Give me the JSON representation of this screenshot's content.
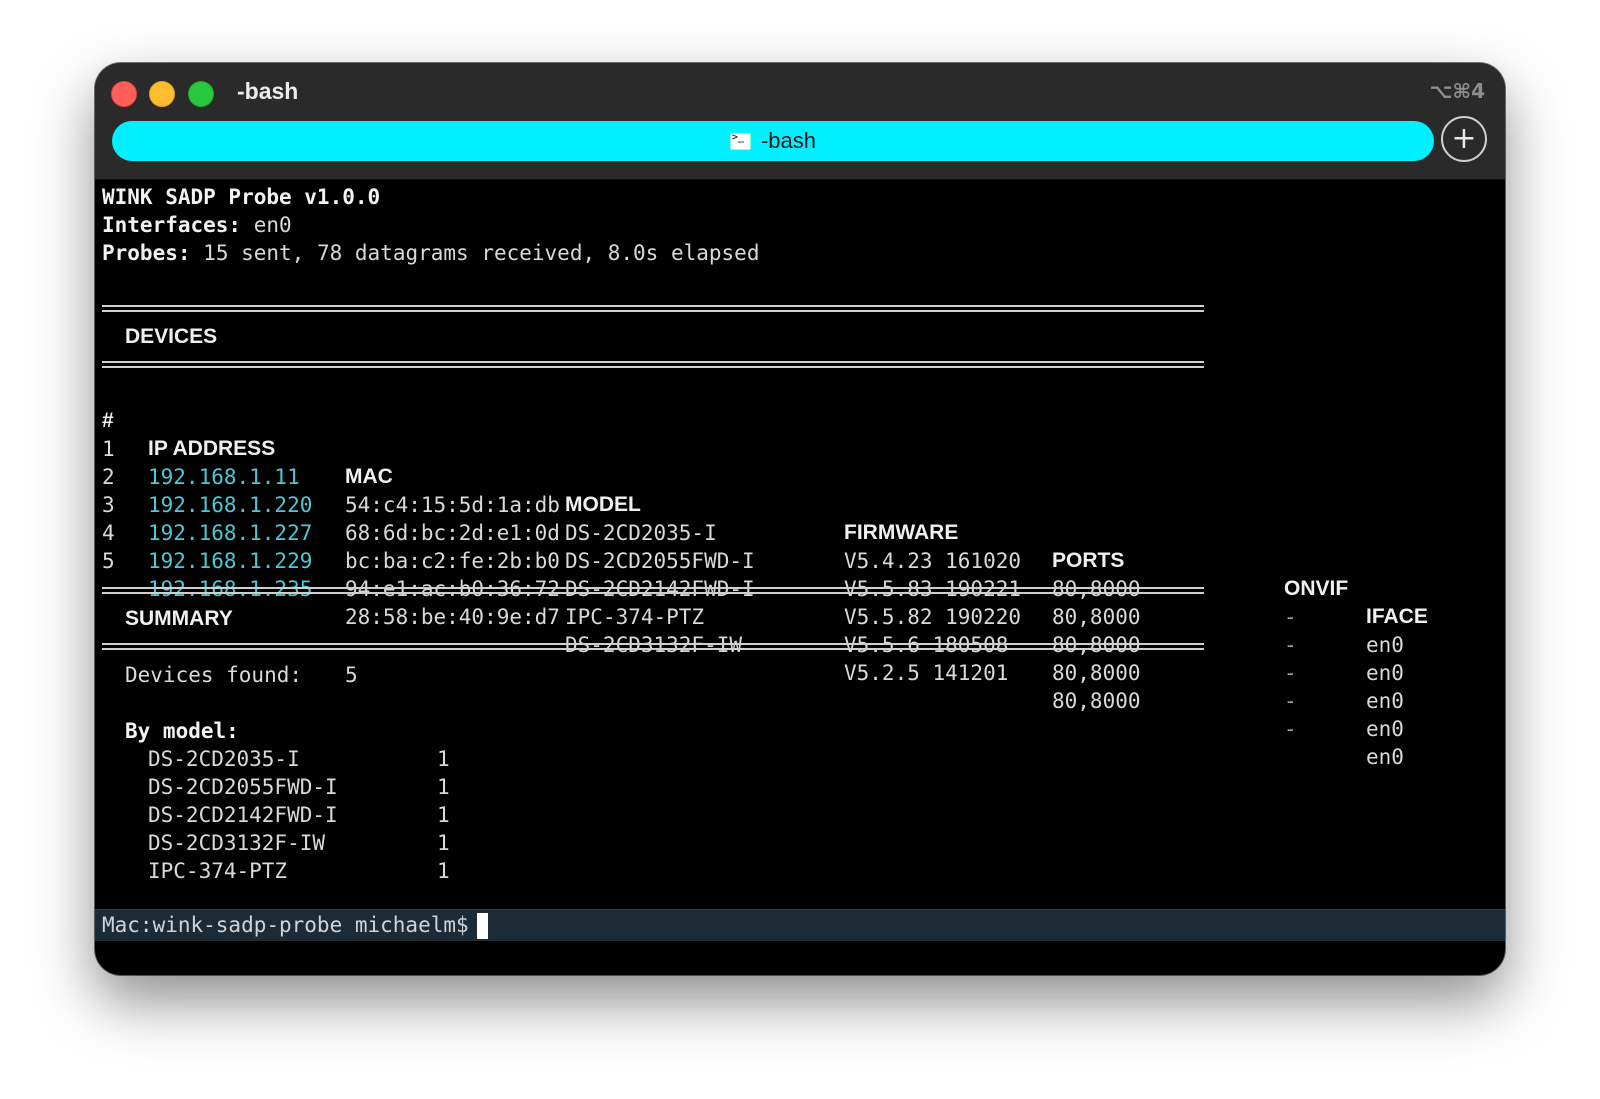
{
  "window": {
    "title": "-bash",
    "shortcut": "⌥⌘4",
    "tab_label": "-bash",
    "new_tab_symbol": "+"
  },
  "header": {
    "app_line": "WINK SADP Probe v1.0.0",
    "interfaces_label": "Interfaces:",
    "interfaces_value": "en0",
    "probes_label": "Probes:",
    "probes_value": "15 sent, 78 datagrams received, 8.0s elapsed"
  },
  "devices": {
    "section_title": "DEVICES",
    "columns": [
      "#",
      "IP ADDRESS",
      "MAC",
      "MODEL",
      "FIRMWARE",
      "PORTS",
      "ONVIF",
      "IFACE"
    ],
    "rows": [
      {
        "num": "1",
        "ip": "192.168.1.11",
        "mac": "54:c4:15:5d:1a:db",
        "model": "DS-2CD2035-I",
        "firmware": "V5.4.23 161020",
        "ports": "80,8000",
        "onvif": "-",
        "iface": "en0"
      },
      {
        "num": "2",
        "ip": "192.168.1.220",
        "mac": "68:6d:bc:2d:e1:0d",
        "model": "DS-2CD2055FWD-I",
        "firmware": "V5.5.83 190221",
        "ports": "80,8000",
        "onvif": "-",
        "iface": "en0"
      },
      {
        "num": "3",
        "ip": "192.168.1.227",
        "mac": "bc:ba:c2:fe:2b:b0",
        "model": "DS-2CD2142FWD-I",
        "firmware": "V5.5.82 190220",
        "ports": "80,8000",
        "onvif": "-",
        "iface": "en0"
      },
      {
        "num": "4",
        "ip": "192.168.1.229",
        "mac": "94:e1:ac:b0:36:72",
        "model": "IPC-374-PTZ",
        "firmware": "V5.5.6 180508",
        "ports": "80,8000",
        "onvif": "-",
        "iface": "en0"
      },
      {
        "num": "5",
        "ip": "192.168.1.235",
        "mac": "28:58:be:40:9e:d7",
        "model": "DS-2CD3132F-IW",
        "firmware": "V5.2.5 141201",
        "ports": "80,8000",
        "onvif": "-",
        "iface": "en0"
      }
    ]
  },
  "summary": {
    "section_title": "SUMMARY",
    "devices_found_label": "Devices found:",
    "devices_found_value": "5",
    "by_model_label": "By model:",
    "by_model": [
      {
        "model": "DS-2CD2035-I",
        "count": "1"
      },
      {
        "model": "DS-2CD2055FWD-I",
        "count": "1"
      },
      {
        "model": "DS-2CD2142FWD-I",
        "count": "1"
      },
      {
        "model": "DS-2CD3132F-IW",
        "count": "1"
      },
      {
        "model": "IPC-374-PTZ",
        "count": "1"
      }
    ]
  },
  "prompt": {
    "text": "Mac:wink-sadp-probe michaelm$"
  },
  "colors": {
    "tab_accent": "#00f0ff",
    "ip_text": "#4fc7d4",
    "prompt_bar": "#1d2b37"
  }
}
